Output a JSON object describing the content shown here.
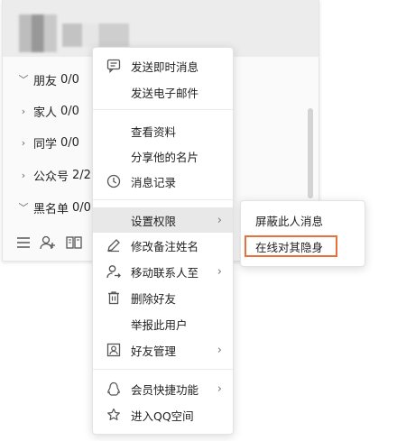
{
  "contacts": {
    "groups": [
      {
        "label": "朋友",
        "count": "0/0",
        "expanded": true
      },
      {
        "label": "家人",
        "count": "0/0",
        "expanded": false
      },
      {
        "label": "同学",
        "count": "0/0",
        "expanded": false
      },
      {
        "label": "公众号",
        "count": "2/2",
        "expanded": false
      },
      {
        "label": "黑名单",
        "count": "0/0",
        "expanded": true
      }
    ],
    "bottom_icons": [
      "menu-icon",
      "add-contact-icon",
      "apps-icon"
    ]
  },
  "context_menu": {
    "items": [
      {
        "label": "发送即时消息",
        "icon": "chat-bubble-icon"
      },
      {
        "label": "发送电子邮件",
        "icon": ""
      },
      {
        "label": "查看资料",
        "icon": ""
      },
      {
        "label": "分享他的名片",
        "icon": ""
      },
      {
        "label": "消息记录",
        "icon": "clock-icon"
      },
      {
        "label": "设置权限",
        "icon": "",
        "submenu": true,
        "active": true
      },
      {
        "label": "修改备注姓名",
        "icon": "pencil-icon"
      },
      {
        "label": "移动联系人至",
        "icon": "move-contact-icon",
        "submenu": true
      },
      {
        "label": "删除好友",
        "icon": "trash-icon"
      },
      {
        "label": "举报此用户",
        "icon": ""
      },
      {
        "label": "好友管理",
        "icon": "contact-card-icon",
        "submenu": true
      },
      {
        "label": "会员快捷功能",
        "icon": "penguin-icon",
        "submenu": true
      },
      {
        "label": "进入QQ空间",
        "icon": "star-icon"
      }
    ]
  },
  "submenu": {
    "items": [
      {
        "label": "屏蔽此人消息"
      },
      {
        "label": "在线对其隐身",
        "highlighted": true
      }
    ],
    "highlight_color": "#e8703a"
  }
}
